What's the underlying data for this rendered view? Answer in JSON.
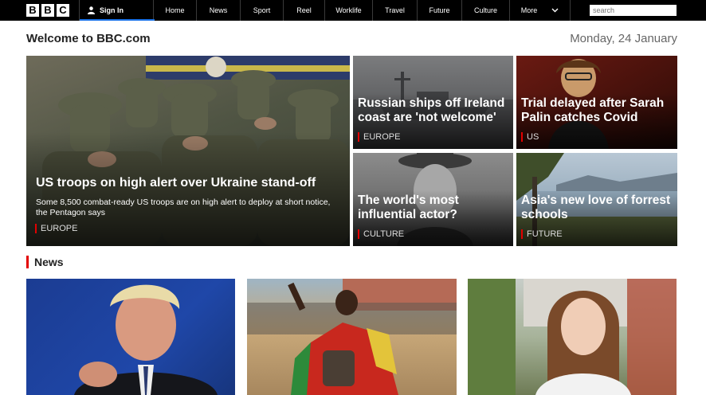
{
  "header": {
    "logo_letters": [
      "B",
      "B",
      "C"
    ],
    "signin_label": "Sign In",
    "nav_items": [
      "Home",
      "News",
      "Sport",
      "Reel",
      "Worklife",
      "Travel",
      "Future",
      "Culture",
      "More"
    ],
    "search_placeholder": "search"
  },
  "page": {
    "welcome": "Welcome to BBC.com",
    "date": "Monday, 24 January"
  },
  "featured": {
    "headline": "US troops on high alert over Ukraine stand-off",
    "summary": "Some 8,500 combat-ready US troops are on high alert to deploy at short notice, the Pentagon says",
    "tag": "EUROPE"
  },
  "stories": [
    {
      "headline": "Russian ships off Ireland coast are 'not welcome'",
      "tag": "EUROPE"
    },
    {
      "headline": "Trial delayed after Sarah Palin catches Covid",
      "tag": "US"
    },
    {
      "headline": "The world's most influential actor?",
      "tag": "CULTURE"
    },
    {
      "headline": "Asia's new love of forrest schools",
      "tag": "FUTURE"
    }
  ],
  "news_section": {
    "title": "News"
  },
  "colors": {
    "topbar": "#000000",
    "accent": "#e30000",
    "signin_underline": "#1a73e8"
  },
  "icons": {
    "signin": "person-icon",
    "more": "chevron-down-icon"
  }
}
